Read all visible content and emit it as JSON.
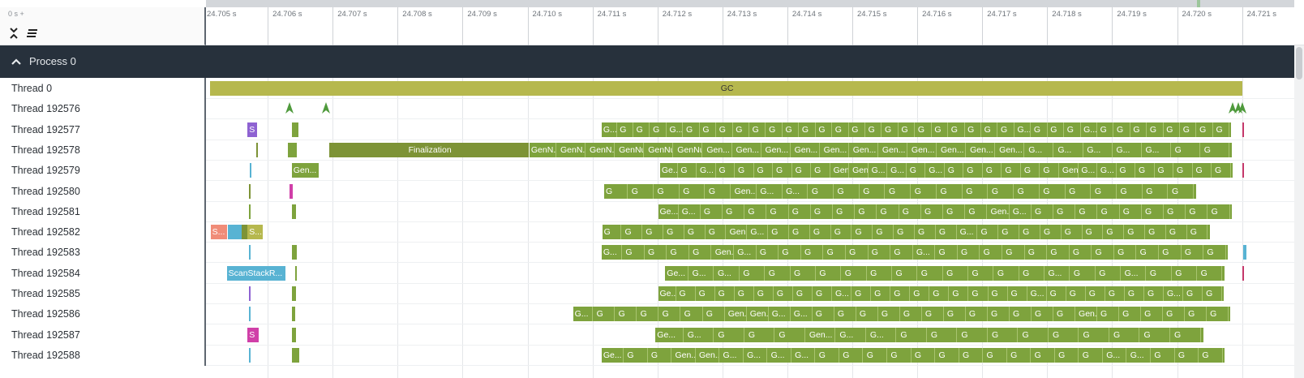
{
  "ruler": {
    "zero_label": "0 s +",
    "ticks": [
      "24.705 s",
      "24.706 s",
      "24.707 s",
      "24.708 s",
      "24.709 s",
      "24.710 s",
      "24.711 s",
      "24.712 s",
      "24.713 s",
      "24.714 s",
      "24.715 s",
      "24.716 s",
      "24.717 s",
      "24.718 s",
      "24.719 s",
      "24.720 s",
      "24.721 s"
    ]
  },
  "toolbar": {
    "collapse_icon": "collapse-all-icon",
    "sort_icon": "sort-lines-icon"
  },
  "process": {
    "title": "Process 0",
    "expand_icon": "chevron-up-icon"
  },
  "colors": {
    "gc": "#b6b84e",
    "gen": "#7ea33d",
    "finalization": "#7d9336",
    "scan": "#58b3d3",
    "s_purple": "#8e62d2",
    "s_pink": "#d03fa8",
    "s_salmon": "#f08c78",
    "header_bg": "#27313c",
    "marker_red": "#c5386a"
  },
  "threads": [
    {
      "name": "Thread 0",
      "slices": [
        {
          "text": "GC",
          "t0": 24.70511,
          "t1": 24.72101,
          "c": "gc"
        }
      ]
    },
    {
      "name": "Thread 192576",
      "instants": [
        24.70634,
        24.7069,
        24.72085,
        24.72094,
        24.72101
      ]
    },
    {
      "name": "Thread 192577",
      "slices": [
        {
          "text": "S",
          "t0": 24.70569,
          "t1": 24.70584,
          "c": "s_purple"
        },
        {
          "text": "",
          "t0": 24.70637,
          "t1": 24.70647,
          "c": "gen"
        }
      ],
      "run": {
        "t0": 24.71114,
        "t1": 24.72083,
        "labels": [
          "G...",
          "G",
          "G",
          "G",
          "G...",
          "G",
          "G",
          "G",
          "G",
          "G",
          "G",
          "G",
          "G",
          "G",
          "G",
          "G",
          "G",
          "G",
          "G",
          "G",
          "G",
          "G",
          "G",
          "G",
          "G",
          "G...",
          "G",
          "G",
          "G",
          "G...",
          "G",
          "G",
          "G",
          "G",
          "G",
          "G",
          "G",
          "G"
        ]
      },
      "end_marker": 24.721
    },
    {
      "name": "Thread 192578",
      "slices": [
        {
          "text": "",
          "t0": 24.70582,
          "t1": 24.70584,
          "c": "finalization"
        },
        {
          "text": "",
          "t0": 24.70631,
          "t1": 24.70645,
          "c": "gen"
        },
        {
          "text": "Finalization",
          "t0": 24.70695,
          "t1": 24.71002,
          "c": "finalization"
        }
      ],
      "run": {
        "t0": 24.71003,
        "t1": 24.72084,
        "labels": [
          "GenN...",
          "GenN...",
          "GenN...",
          "GenNur...",
          "GenNurseryP...",
          "GenNurseryPr...",
          "Gen...",
          "Gen...",
          "Gen...",
          "Gen...",
          "Gen...",
          "Gen...",
          "Gen...",
          "Gen...",
          "Gen...",
          "Gen...",
          "Gen...",
          "G...",
          "G...",
          "G...",
          "G...",
          "G...",
          "G",
          "G"
        ]
      }
    },
    {
      "name": "Thread 192579",
      "slices": [
        {
          "text": "",
          "t0": 24.70572,
          "t1": 24.70575,
          "c": "scan"
        },
        {
          "text": "Gen...",
          "t0": 24.70637,
          "t1": 24.70678,
          "c": "gen"
        }
      ],
      "run": {
        "t0": 24.71204,
        "t1": 24.72085,
        "labels": [
          "Ge...",
          "G",
          "G...",
          "G",
          "G",
          "G",
          "G",
          "G",
          "G",
          "Gen...",
          "Gen...",
          "G...",
          "G...",
          "G",
          "G...",
          "G",
          "G",
          "G",
          "G",
          "G",
          "G",
          "Gen...",
          "G...",
          "G...",
          "G",
          "G",
          "G",
          "G",
          "G",
          "G"
        ]
      },
      "end_marker": 24.721
    },
    {
      "name": "Thread 192580",
      "slices": [
        {
          "text": "",
          "t0": 24.70571,
          "t1": 24.70574,
          "c": "finalization"
        },
        {
          "text": "",
          "t0": 24.70634,
          "t1": 24.70639,
          "c": "s_pink"
        }
      ],
      "run": {
        "t0": 24.71118,
        "t1": 24.72029,
        "labels": [
          "G",
          "G",
          "G",
          "G",
          "G",
          "Gen...",
          "G...",
          "G...",
          "G",
          "G",
          "G",
          "G",
          "G",
          "G",
          "G",
          "G",
          "G",
          "G",
          "G",
          "G",
          "G",
          "G",
          "G"
        ]
      }
    },
    {
      "name": "Thread 192581",
      "slices": [
        {
          "text": "",
          "t0": 24.70571,
          "t1": 24.70573,
          "c": "gen"
        },
        {
          "text": "",
          "t0": 24.70637,
          "t1": 24.70643,
          "c": "gen"
        }
      ],
      "run": {
        "t0": 24.71201,
        "t1": 24.72084,
        "labels": [
          "Ge...",
          "G...",
          "G",
          "G",
          "G",
          "G",
          "G",
          "G",
          "G",
          "G",
          "G",
          "G",
          "G",
          "G",
          "G",
          "Gen...",
          "G...",
          "G",
          "G",
          "G",
          "G",
          "G",
          "G",
          "G",
          "G",
          "G"
        ]
      }
    },
    {
      "name": "Thread 192582",
      "slices": [
        {
          "text": "S...",
          "t0": 24.70512,
          "t1": 24.70537,
          "c": "s_salmon"
        },
        {
          "text": "",
          "t0": 24.70539,
          "t1": 24.7056,
          "c": "scan"
        },
        {
          "text": "",
          "t0": 24.7056,
          "t1": 24.70569,
          "c": "finalization"
        },
        {
          "text": "S...",
          "t0": 24.70569,
          "t1": 24.70593,
          "c": "gc"
        }
      ],
      "run": {
        "t0": 24.71115,
        "t1": 24.7205,
        "labels": [
          "G",
          "G",
          "G",
          "G",
          "G",
          "G",
          "Gen...",
          "G...",
          "G",
          "G",
          "G",
          "G",
          "G",
          "G",
          "G",
          "G",
          "G",
          "G...",
          "G",
          "G",
          "G",
          "G",
          "G",
          "G",
          "G",
          "G",
          "G",
          "G",
          "G"
        ]
      }
    },
    {
      "name": "Thread 192583",
      "slices": [
        {
          "text": "",
          "t0": 24.70571,
          "t1": 24.70574,
          "c": "scan"
        },
        {
          "text": "",
          "t0": 24.70637,
          "t1": 24.70645,
          "c": "gen"
        }
      ],
      "run": {
        "t0": 24.71114,
        "t1": 24.72078,
        "labels": [
          "G...",
          "G",
          "G",
          "G",
          "G",
          "Gen...",
          "G...",
          "G",
          "G",
          "G",
          "G",
          "G",
          "G",
          "G",
          "G...",
          "G",
          "G",
          "G",
          "G",
          "G",
          "G",
          "G",
          "G",
          "G",
          "G",
          "G",
          "G",
          "G"
        ]
      },
      "end_marker_scan": 24.72102
    },
    {
      "name": "Thread 192584",
      "slices": [
        {
          "text": "ScanStackR...",
          "t0": 24.70537,
          "t1": 24.70627,
          "c": "scan"
        },
        {
          "text": "",
          "t0": 24.70642,
          "t1": 24.70643,
          "c": "gen"
        }
      ],
      "run": {
        "t0": 24.71212,
        "t1": 24.72073,
        "labels": [
          "Ge...",
          "G...",
          "G...",
          "G",
          "G",
          "G",
          "G",
          "G",
          "G",
          "G",
          "G",
          "G",
          "G",
          "G",
          "G",
          "G...",
          "G",
          "G",
          "G...",
          "G",
          "G",
          "G"
        ]
      },
      "end_marker": 24.721
    },
    {
      "name": "Thread 192585",
      "slices": [
        {
          "text": "",
          "t0": 24.70571,
          "t1": 24.70574,
          "c": "s_purple"
        },
        {
          "text": "",
          "t0": 24.70637,
          "t1": 24.70644,
          "c": "gen"
        }
      ],
      "run": {
        "t0": 24.71201,
        "t1": 24.72072,
        "labels": [
          "Ge...",
          "G",
          "G",
          "G",
          "G",
          "G",
          "G",
          "G",
          "G",
          "G...",
          "G",
          "G",
          "G",
          "G",
          "G",
          "G",
          "G",
          "G",
          "G",
          "G...",
          "G",
          "G",
          "G",
          "G",
          "G",
          "G",
          "G...",
          "G",
          "G"
        ]
      }
    },
    {
      "name": "Thread 192586",
      "slices": [
        {
          "text": "",
          "t0": 24.70571,
          "t1": 24.70573,
          "c": "scan"
        },
        {
          "text": "",
          "t0": 24.70637,
          "t1": 24.70642,
          "c": "gen"
        }
      ],
      "run": {
        "t0": 24.7107,
        "t1": 24.72082,
        "labels": [
          "G...",
          "G",
          "G",
          "G",
          "G",
          "G",
          "G",
          "Gen...",
          "Gen...",
          "G...",
          "G...",
          "G",
          "G",
          "G",
          "G",
          "G",
          "G",
          "G",
          "G",
          "G",
          "G",
          "G",
          "G",
          "Gen...",
          "G",
          "G",
          "G",
          "G",
          "G",
          "G"
        ]
      }
    },
    {
      "name": "Thread 192587",
      "slices": [
        {
          "text": "S",
          "t0": 24.70569,
          "t1": 24.70586,
          "c": "s_pink"
        },
        {
          "text": "",
          "t0": 24.70637,
          "t1": 24.70643,
          "c": "gen"
        }
      ],
      "run": {
        "t0": 24.71197,
        "t1": 24.7204,
        "labels": [
          "Ge...",
          "G...",
          "G",
          "G",
          "G",
          "Gen...",
          "G...",
          "G...",
          "G",
          "G",
          "G",
          "G",
          "G",
          "G",
          "G",
          "G",
          "G",
          "G"
        ]
      }
    },
    {
      "name": "Thread 192588",
      "slices": [
        {
          "text": "",
          "t0": 24.70571,
          "t1": 24.70574,
          "c": "scan"
        },
        {
          "text": "",
          "t0": 24.70637,
          "t1": 24.70648,
          "c": "gen"
        }
      ],
      "run": {
        "t0": 24.71114,
        "t1": 24.72073,
        "labels": [
          "Ge...",
          "G",
          "G",
          "Gen...",
          "Gen...",
          "G...",
          "G...",
          "G...",
          "G...",
          "G",
          "G",
          "G",
          "G",
          "G",
          "G",
          "G",
          "G",
          "G",
          "G",
          "G",
          "G",
          "G...",
          "G...",
          "G",
          "G",
          "G"
        ]
      }
    }
  ]
}
